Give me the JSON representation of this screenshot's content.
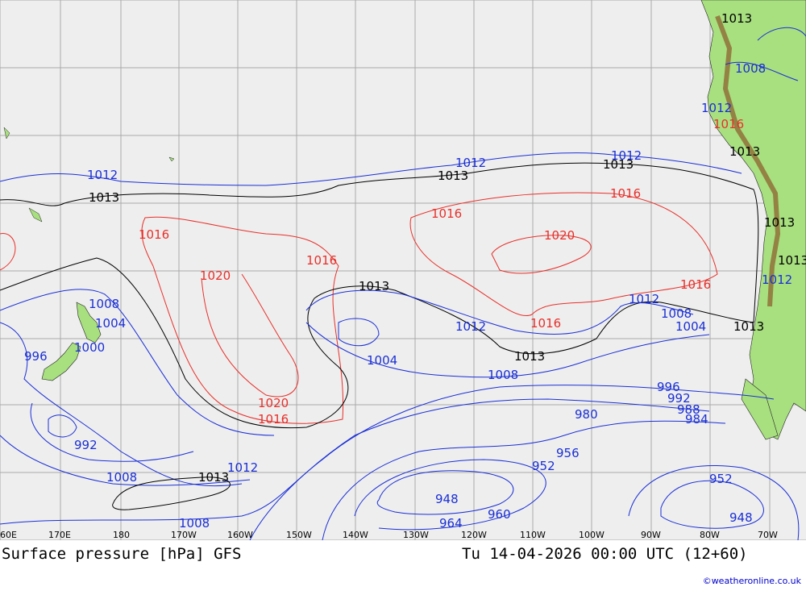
{
  "title": "Surface pressure [hPa] GFS",
  "valid_time": "Tu 14-04-2026 00:00 UTC (12+60)",
  "credit": "©weatheronline.co.uk",
  "colors": {
    "ocean": "#eeeeee",
    "land": "#a8e080",
    "grid": "#aaaaaa",
    "low_isobar": "#1a2fd6",
    "high_isobar": "#e8302a",
    "reference_isobar": "#000000",
    "andes": "#8a5a2a"
  },
  "longitude_labels": [
    "60E",
    "170E",
    "180",
    "170W",
    "160W",
    "150W",
    "140W",
    "130W",
    "120W",
    "110W",
    "100W",
    "90W",
    "80W",
    "70W"
  ],
  "isobar_labels": [
    {
      "text": "1012",
      "kind": "low"
    },
    {
      "text": "1013",
      "kind": "ref"
    },
    {
      "text": "1016",
      "kind": "high"
    },
    {
      "text": "1020",
      "kind": "high"
    },
    {
      "text": "1008",
      "kind": "low"
    },
    {
      "text": "1004",
      "kind": "low"
    },
    {
      "text": "1000",
      "kind": "low"
    },
    {
      "text": "996",
      "kind": "low"
    },
    {
      "text": "992",
      "kind": "low"
    },
    {
      "text": "988",
      "kind": "low"
    },
    {
      "text": "984",
      "kind": "low"
    },
    {
      "text": "980",
      "kind": "low"
    },
    {
      "text": "956",
      "kind": "low"
    },
    {
      "text": "952",
      "kind": "low"
    },
    {
      "text": "948",
      "kind": "low"
    },
    {
      "text": "960",
      "kind": "low"
    },
    {
      "text": "964",
      "kind": "low"
    }
  ]
}
